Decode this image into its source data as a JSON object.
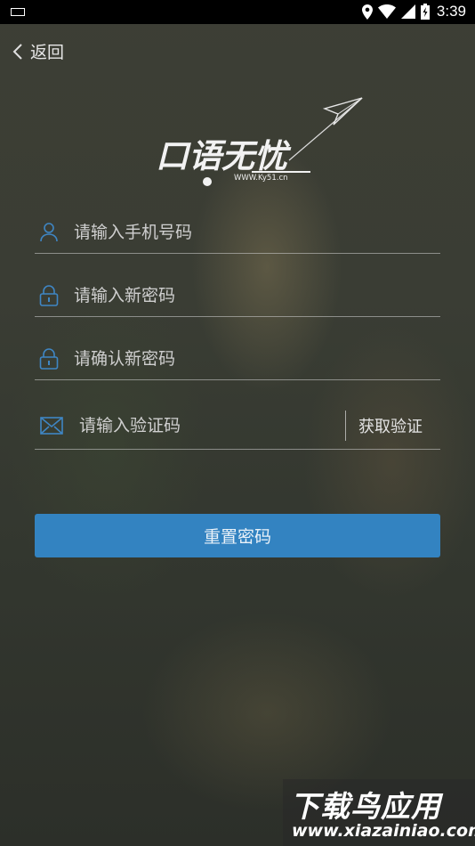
{
  "status_bar": {
    "time": "3:39"
  },
  "nav": {
    "back_label": "返回"
  },
  "logo": {
    "text": "口语无忧",
    "url": "WWW.Ky51.cn"
  },
  "form": {
    "phone_placeholder": "请输入手机号码",
    "new_password_placeholder": "请输入新密码",
    "confirm_password_placeholder": "请确认新密码",
    "code_placeholder": "请输入验证码",
    "get_code_label": "获取验证",
    "submit_label": "重置密码"
  },
  "watermark": {
    "title": "下载鸟应用",
    "url": "www.xiazainiao.com"
  },
  "colors": {
    "accent": "#3383c1",
    "icon": "#3f86c4"
  }
}
